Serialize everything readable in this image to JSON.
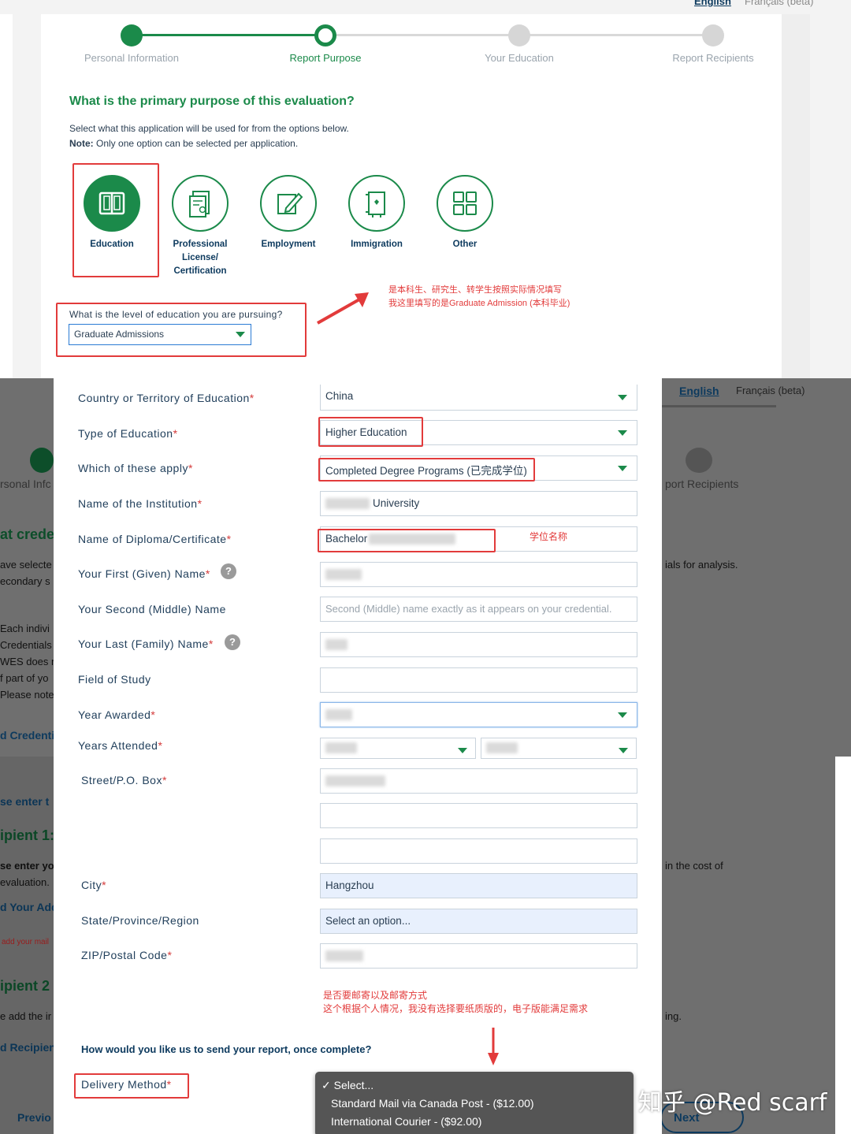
{
  "top": {
    "lang": {
      "english": "English",
      "french": "Français (beta)"
    },
    "steps": [
      {
        "label": "Personal Information",
        "state": "done"
      },
      {
        "label": "Report Purpose",
        "state": "current"
      },
      {
        "label": "Your Education",
        "state": "todo"
      },
      {
        "label": "Report Recipients",
        "state": "todo"
      }
    ],
    "question": "What is the primary purpose of this evaluation?",
    "description": "Select what this application will be used for from the options below.",
    "note_prefix": "Note:",
    "note_text": " Only one option can be selected per application.",
    "options": [
      {
        "label": "Education",
        "icon": "book-icon",
        "selected": true
      },
      {
        "label": "Professional License/ Certification",
        "icon": "document-certificate-icon",
        "selected": false
      },
      {
        "label": "Employment",
        "icon": "pencil-edit-icon",
        "selected": false
      },
      {
        "label": "Immigration",
        "icon": "passport-icon",
        "selected": false
      },
      {
        "label": "Other",
        "icon": "grid-icon",
        "selected": false
      }
    ],
    "level_label": "What is the level of education you are pursuing?",
    "level_value": "Graduate Admissions",
    "annotation_line1": "是本科生、研究生、转学生按照实际情况填写",
    "annotation_line2": "我这里填写的是Graduate Admission (本科毕业)"
  },
  "bottom": {
    "background_text": {
      "english": "English",
      "french": "Français (beta)",
      "personal_info_fragment": "rsonal Infc",
      "report_recipients_fragment": "port Recipients",
      "at_crede": "at crede",
      "ave_selecte": "ave selecte",
      "econdary_s": "econdary s",
      "ials_for_analysis": "ials for analysis.",
      "each_indivi": "Each indivi",
      "credentials": "Credentials",
      "wes_does": "WES does n",
      "f_part_of": "f part of yo",
      "please_note": "Please note",
      "d_credenti": "d Credenti",
      "se_enter_t": "se enter t",
      "ipient_1": "ipient 1:",
      "se_enter_you": "se enter you",
      "evaluation": "evaluation.",
      "d_your_add": "d Your Add",
      "add_your_mail": "add your mail",
      "in_the_cost_of": "in the cost of",
      "ipient_2": "ipient 2",
      "e_add_the_ir": "e add the ir",
      "ing": "ing.",
      "d_recipien": "d Recipien",
      "previo": "Previo",
      "next": "Next"
    },
    "fields": [
      {
        "label": "Country or Territory of Education",
        "required": true,
        "value": "China",
        "dropdown": true
      },
      {
        "label": "Type of Education",
        "required": true,
        "value": "Higher Education",
        "dropdown": true
      },
      {
        "label": "Which of these apply",
        "required": true,
        "value": "Completed Degree Programs (已完成学位)",
        "dropdown": true
      },
      {
        "label": "Name of the Institution",
        "required": true,
        "value": "University"
      },
      {
        "label": "Name of Diploma/Certificate",
        "required": true,
        "value": "Bachelor"
      },
      {
        "label": "Your First (Given) Name",
        "required": true,
        "value": ""
      },
      {
        "label": "Your Second (Middle) Name",
        "required": false,
        "placeholder": "Second (Middle) name exactly as it appears on your credential."
      },
      {
        "label": "Your Last (Family) Name",
        "required": true,
        "value": ""
      },
      {
        "label": "Field of Study",
        "required": false,
        "value": ""
      },
      {
        "label": "Year Awarded",
        "required": true,
        "value": "",
        "dropdown": true
      },
      {
        "label": "Years Attended",
        "required": true,
        "value": "",
        "dropdown": true
      },
      {
        "label": "Street/P.O. Box",
        "required": true,
        "value": ""
      },
      {
        "label": "City",
        "required": true,
        "value": "Hangzhou"
      },
      {
        "label": "State/Province/Region",
        "required": false,
        "value": "Select an option..."
      },
      {
        "label": "ZIP/Postal Code",
        "required": true,
        "value": ""
      }
    ],
    "diploma_annotation": "学位名称",
    "mail_annotation_line1": "是否要邮寄以及邮寄方式",
    "mail_annotation_line2": "这个根据个人情况，我没有选择要纸质版的，电子版能满足需求",
    "send_question": "How would you like us to send your report, once complete?",
    "delivery_label": "Delivery Method",
    "delivery_options": [
      "✓ Select...",
      "Standard Mail via Canada Post - ($12.00)",
      "International Courier - ($92.00)"
    ],
    "watermark": "知乎 @Red scarf"
  },
  "colors": {
    "brand_green": "#1b8a4a",
    "annotation_red": "#e23b3b",
    "label_navy": "#22405c"
  }
}
